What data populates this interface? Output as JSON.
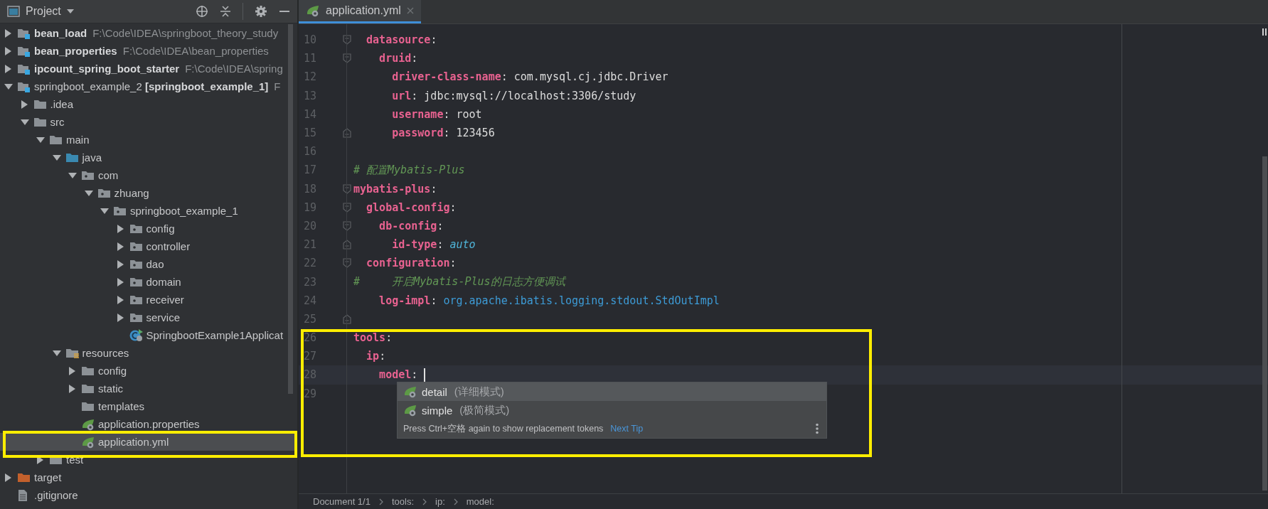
{
  "project_panel": {
    "title": "Project"
  },
  "tree": {
    "items": [
      {
        "kind": "module",
        "name": "**bean_load**",
        "path": "F:\\Code\\IDEA\\springboot_theory_study",
        "expanded": false,
        "selected": false
      },
      {
        "kind": "module",
        "name": "**bean_properties**",
        "path": "F:\\Code\\IDEA\\bean_properties",
        "expanded": false,
        "selected": false
      },
      {
        "kind": "module",
        "name": "**ipcount_spring_boot_starter**",
        "path": "F:\\Code\\IDEA\\spring",
        "expanded": false,
        "selected": false
      },
      {
        "kind": "module",
        "name": "springboot_example_2 **[springboot_example_1]**",
        "path": "F",
        "expanded": true,
        "selected": false,
        "children": [
          {
            "kind": "folder",
            "name": ".idea",
            "expanded": false,
            "selected": false
          },
          {
            "kind": "folder",
            "name": "src",
            "expanded": true,
            "selected": false,
            "children": [
              {
                "kind": "folder",
                "name": "main",
                "expanded": true,
                "selected": false,
                "children": [
                  {
                    "kind": "source",
                    "name": "java",
                    "expanded": true,
                    "selected": false,
                    "children": [
                      {
                        "kind": "package",
                        "name": "com",
                        "expanded": true,
                        "selected": false,
                        "children": [
                          {
                            "kind": "package",
                            "name": "zhuang",
                            "expanded": true,
                            "selected": false,
                            "children": [
                              {
                                "kind": "package",
                                "name": "springboot_example_1",
                                "expanded": true,
                                "selected": false,
                                "children": [
                                  {
                                    "kind": "package",
                                    "name": "config",
                                    "expanded": false,
                                    "selected": false
                                  },
                                  {
                                    "kind": "package",
                                    "name": "controller",
                                    "expanded": false,
                                    "selected": false
                                  },
                                  {
                                    "kind": "package",
                                    "name": "dao",
                                    "expanded": false,
                                    "selected": false
                                  },
                                  {
                                    "kind": "package",
                                    "name": "domain",
                                    "expanded": false,
                                    "selected": false
                                  },
                                  {
                                    "kind": "package",
                                    "name": "receiver",
                                    "expanded": false,
                                    "selected": false
                                  },
                                  {
                                    "kind": "package",
                                    "name": "service",
                                    "expanded": false,
                                    "selected": false
                                  },
                                  {
                                    "kind": "spring-class",
                                    "name": "SpringbootExample1Applicat",
                                    "selected": false
                                  }
                                ]
                              }
                            ]
                          }
                        ]
                      }
                    ]
                  },
                  {
                    "kind": "resources",
                    "name": "resources",
                    "expanded": true,
                    "selected": false,
                    "children": [
                      {
                        "kind": "folder",
                        "name": "config",
                        "expanded": false,
                        "selected": false
                      },
                      {
                        "kind": "folder",
                        "name": "static",
                        "expanded": false,
                        "selected": false
                      },
                      {
                        "kind": "folder",
                        "name": "templates",
                        "selected": false
                      },
                      {
                        "kind": "spring-config",
                        "name": "application.properties",
                        "selected": false
                      },
                      {
                        "kind": "spring-config",
                        "name": "application.yml",
                        "selected": true
                      }
                    ]
                  }
                ]
              },
              {
                "kind": "folder",
                "name": "test",
                "expanded": false,
                "selected": false
              }
            ]
          }
        ]
      },
      {
        "kind": "excluded",
        "name": "target",
        "expanded": false,
        "selected": false
      },
      {
        "kind": "text-file",
        "name": ".gitignore",
        "selected": false
      }
    ]
  },
  "tabs": [
    {
      "label": "application.yml",
      "selected": true
    }
  ],
  "editor": {
    "lines": [
      {
        "number": "10",
        "kind": "fold-start",
        "current": false,
        "tokens": [
          {
            "kind": "key",
            "text": "  datasource"
          },
          {
            "kind": "punct",
            "text": ":"
          }
        ]
      },
      {
        "number": "11",
        "kind": "fold-start",
        "current": false,
        "tokens": [
          {
            "kind": "key",
            "text": "    druid"
          },
          {
            "kind": "punct",
            "text": ":"
          }
        ]
      },
      {
        "number": "12",
        "current": false,
        "tokens": [
          {
            "kind": "key",
            "text": "      driver-class-name"
          },
          {
            "kind": "punct",
            "text": ": "
          },
          {
            "kind": "text",
            "text": "com.mysql.cj.jdbc.Driver"
          }
        ]
      },
      {
        "number": "13",
        "current": false,
        "tokens": [
          {
            "kind": "key",
            "text": "      url"
          },
          {
            "kind": "punct",
            "text": ": "
          },
          {
            "kind": "text",
            "text": "jdbc:mysql://localhost:3306/study"
          }
        ]
      },
      {
        "number": "14",
        "current": false,
        "tokens": [
          {
            "kind": "key",
            "text": "      username"
          },
          {
            "kind": "punct",
            "text": ": "
          },
          {
            "kind": "text",
            "text": "root"
          }
        ]
      },
      {
        "number": "15",
        "kind": "fold-end",
        "current": false,
        "tokens": [
          {
            "kind": "key",
            "text": "      password"
          },
          {
            "kind": "punct",
            "text": ": "
          },
          {
            "kind": "text",
            "text": "123456"
          }
        ]
      },
      {
        "number": "16",
        "current": false
      },
      {
        "number": "17",
        "current": false,
        "tokens": [
          {
            "kind": "comment",
            "text": "# 配置Mybatis-Plus"
          }
        ]
      },
      {
        "number": "18",
        "kind": "fold-start",
        "current": false,
        "tokens": [
          {
            "kind": "key",
            "text": "mybatis-plus"
          },
          {
            "kind": "punct",
            "text": ":"
          }
        ]
      },
      {
        "number": "19",
        "kind": "fold-start",
        "current": false,
        "tokens": [
          {
            "kind": "key",
            "text": "  global-config"
          },
          {
            "kind": "punct",
            "text": ":"
          }
        ]
      },
      {
        "number": "20",
        "kind": "fold-start",
        "current": false,
        "tokens": [
          {
            "kind": "key",
            "text": "    db-config"
          },
          {
            "kind": "punct",
            "text": ":"
          }
        ]
      },
      {
        "number": "21",
        "kind": "fold-end",
        "current": false,
        "tokens": [
          {
            "kind": "key",
            "text": "      id-type"
          },
          {
            "kind": "punct",
            "text": ": "
          },
          {
            "kind": "enum",
            "text": "auto"
          }
        ]
      },
      {
        "number": "22",
        "kind": "fold-start",
        "current": false,
        "tokens": [
          {
            "kind": "key",
            "text": "  configuration"
          },
          {
            "kind": "punct",
            "text": ":"
          }
        ]
      },
      {
        "number": "23",
        "current": false,
        "tokens": [
          {
            "kind": "comment",
            "text": "#     开启Mybatis-Plus的日志方便调试"
          }
        ]
      },
      {
        "number": "24",
        "current": false,
        "tokens": [
          {
            "kind": "key",
            "text": "    log-impl"
          },
          {
            "kind": "punct",
            "text": ": "
          },
          {
            "kind": "class",
            "text": "org.apache.ibatis.logging.stdout.StdOutImpl"
          }
        ]
      },
      {
        "number": "25",
        "kind": "fold-end",
        "current": false
      },
      {
        "number": "26",
        "current": false,
        "tokens": [
          {
            "kind": "key",
            "text": "tools"
          },
          {
            "kind": "punct",
            "text": ":"
          }
        ]
      },
      {
        "number": "27",
        "current": false,
        "tokens": [
          {
            "kind": "key",
            "text": "  ip"
          },
          {
            "kind": "punct",
            "text": ":"
          }
        ]
      },
      {
        "number": "28",
        "current": true,
        "tokens": [
          {
            "kind": "key",
            "text": "    model"
          },
          {
            "kind": "punct",
            "text": ": "
          }
        ]
      },
      {
        "number": "29",
        "current": false
      }
    ]
  },
  "completion": {
    "items": [
      {
        "label": "detail",
        "hint": "(详细模式)",
        "selected": true
      },
      {
        "label": "simple",
        "hint": "(极简模式)",
        "selected": false
      }
    ],
    "tip": "Press Ctrl+空格 again to show replacement tokens",
    "link": "Next Tip"
  },
  "breadcrumb": [
    "Document 1/1",
    "tools:",
    "ip:",
    "model:"
  ]
}
